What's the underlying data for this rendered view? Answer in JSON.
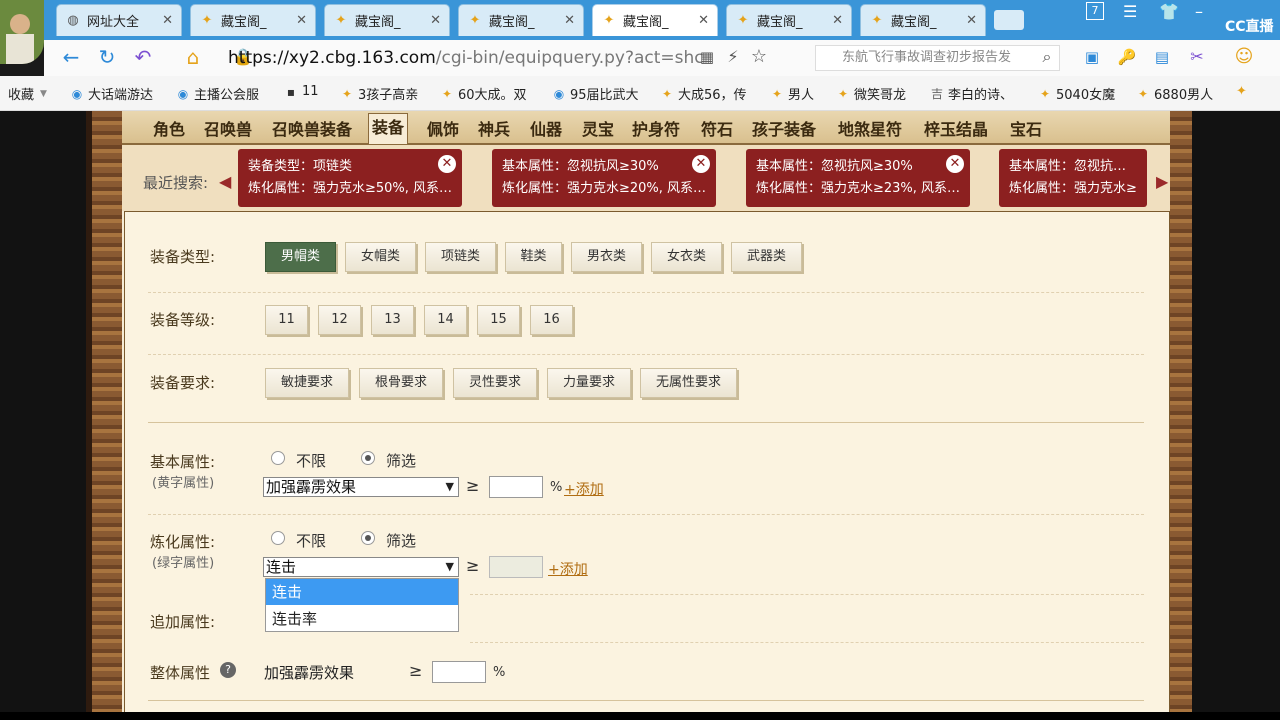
{
  "browser": {
    "tabs": [
      {
        "label": "网址大全",
        "icon": "globe-icon"
      },
      {
        "label": "藏宝阁_",
        "icon": "treasure-icon"
      },
      {
        "label": "藏宝阁_",
        "icon": "treasure-icon"
      },
      {
        "label": "藏宝阁_",
        "icon": "treasure-icon"
      },
      {
        "label": "藏宝阁_",
        "icon": "treasure-icon",
        "active": true
      },
      {
        "label": "藏宝阁_",
        "icon": "treasure-icon"
      },
      {
        "label": "藏宝阁_",
        "icon": "treasure-icon"
      }
    ],
    "tab_close": "✕",
    "badge_count": "7",
    "url_domain": "https://xy2.cbg.163.com",
    "url_rest": "/cgi-bin/equipquery.py?act=shc",
    "search_placeholder": "东航飞行事故调查初步报告发",
    "overlay_logo": "CC直播",
    "bookmarks": [
      "收藏",
      "大话端游达",
      "主播公会服",
      "11",
      "3孩子高亲",
      "60大成。双",
      "95届比武大",
      "大成56，传",
      "男人",
      "微笑哥龙",
      "李白的诗、",
      "5040女魔",
      "6880男人"
    ]
  },
  "nav": {
    "items": [
      "角色",
      "召唤兽",
      "召唤兽装备",
      "装备",
      "佩饰",
      "神兵",
      "仙器",
      "灵宝",
      "护身符",
      "符石",
      "孩子装备",
      "地煞星符",
      "梓玉结晶",
      "宝石"
    ],
    "active_index": 3
  },
  "recent": {
    "label": "最近搜索:",
    "chips": [
      {
        "line1": "装备类型：项链类",
        "line2": "炼化属性：强力克水≥50%, 风系…"
      },
      {
        "line1": "基本属性：忽视抗风≥30%",
        "line2": "炼化属性：强力克水≥20%, 风系…"
      },
      {
        "line1": "基本属性：忽视抗风≥30%",
        "line2": "炼化属性：强力克水≥23%, 风系…"
      },
      {
        "line1": "基本属性：忽视抗风≥",
        "line2": "炼化属性：强力克水≥"
      }
    ],
    "chip_close": "✕"
  },
  "filters": {
    "type_label": "装备类型:",
    "types": [
      "男帽类",
      "女帽类",
      "项链类",
      "鞋类",
      "男衣类",
      "女衣类",
      "武器类"
    ],
    "type_selected": 0,
    "level_label": "装备等级:",
    "levels": [
      "11",
      "12",
      "13",
      "14",
      "15",
      "16"
    ],
    "req_label": "装备要求:",
    "reqs": [
      "敏捷要求",
      "根骨要求",
      "灵性要求",
      "力量要求",
      "无属性要求"
    ],
    "basic_label": "基本属性:",
    "basic_sub": "(黄字属性)",
    "radio_none": "不限",
    "radio_filter": "筛选",
    "basic_select": "加强霹雳效果",
    "refine_label": "炼化属性:",
    "refine_sub": "(绿字属性)",
    "refine_select": "连击",
    "refine_options": [
      "连击",
      "连击率"
    ],
    "refine_highlight": 0,
    "ge": "≥",
    "percent": "%",
    "add_link": "+添加",
    "extra_label": "追加属性:",
    "overall_label": "整体属性",
    "overall_value": "加强霹雳效果"
  }
}
